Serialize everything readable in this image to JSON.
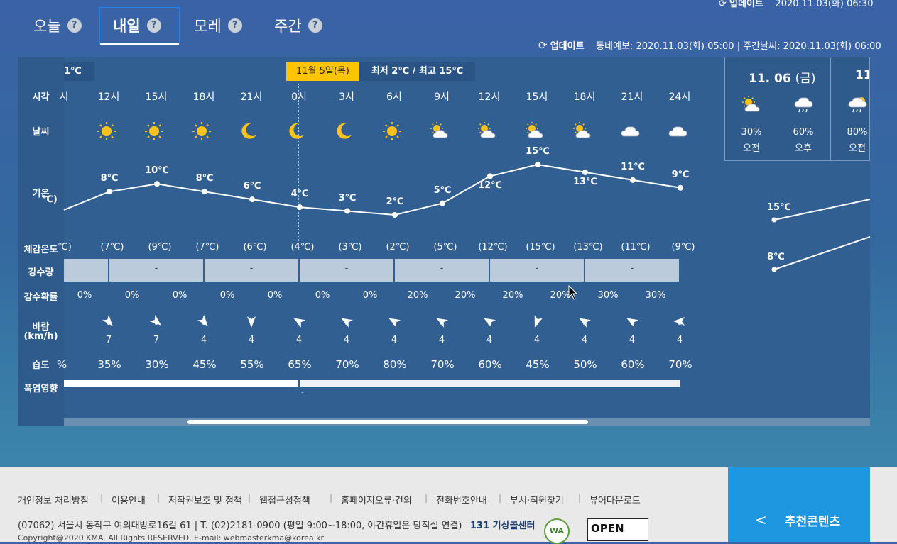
{
  "tabs": [
    {
      "label": "오늘"
    },
    {
      "label": "내일"
    },
    {
      "label": "모레"
    },
    {
      "label": "주간"
    }
  ],
  "help_glyph": "?",
  "update": {
    "label": "업데이트",
    "info": "동네예보: 2020.11.03(화) 05:00 | 주간날씨: 2020.11.03(화) 06:00",
    "top_info": "2020.11.03(화) 06:30"
  },
  "row_labels": {
    "time": "시각",
    "weather": "날씨",
    "temp": "기온",
    "feel": "체감온도",
    "precip": "강수량",
    "prob": "강수확률",
    "wind": "바람",
    "wind_unit": "(km/h)",
    "humidity": "습도",
    "heat": "폭염영향"
  },
  "day": {
    "badge": "11월 5일(목)",
    "minmax": "최저 2℃ / 최고 15℃",
    "prev_temp": "1℃"
  },
  "hours": [
    "시",
    "12시",
    "15시",
    "18시",
    "21시",
    "0시",
    "3시",
    "6시",
    "9시",
    "12시",
    "15시",
    "18시",
    "21시",
    "24시"
  ],
  "weather_icons": [
    "sun-icon",
    "sun-icon",
    "sun-icon",
    "moon-icon",
    "moon-icon",
    "moon-icon",
    "sun-icon",
    "sun-cloud-icon",
    "sun-cloud-icon",
    "sun-cloud-icon",
    "sun-cloud-icon",
    "cloud-icon",
    "cloud-icon"
  ],
  "temps": [
    "8℃",
    "10℃",
    "8℃",
    "6℃",
    "4℃",
    "3℃",
    "2℃",
    "5℃",
    "12℃",
    "15℃",
    "13℃",
    "11℃",
    "9℃"
  ],
  "temp_values": [
    8,
    10,
    8,
    6,
    4,
    3,
    2,
    5,
    12,
    15,
    13,
    11,
    9
  ],
  "feels": [
    "℃)",
    "(7℃)",
    "(9℃)",
    "(7℃)",
    "(6℃)",
    "(4℃)",
    "(3℃)",
    "(2℃)",
    "(5℃)",
    "(12℃)",
    "(15℃)",
    "(13℃)",
    "(11℃)",
    "(9℃)"
  ],
  "precip": [
    "-",
    "-",
    "-",
    "-",
    "-",
    "-"
  ],
  "prob": [
    "0%",
    "0%",
    "0%",
    "0%",
    "0%",
    "0%",
    "0%",
    "20%",
    "20%",
    "20%",
    "20%",
    "30%",
    "30%"
  ],
  "wind_speeds": [
    "",
    "7",
    "7",
    "4",
    "4",
    "4",
    "4",
    "4",
    "4",
    "4",
    "4",
    "4",
    "4",
    "4"
  ],
  "humidity": [
    "%",
    "35%",
    "30%",
    "45%",
    "55%",
    "65%",
    "70%",
    "80%",
    "70%",
    "60%",
    "45%",
    "50%",
    "60%",
    "70%"
  ],
  "heat_dash": "-",
  "outlook": {
    "date": "11. 06",
    "dow": "(금)",
    "next_date": "11",
    "items": [
      {
        "icon": "sun-cloud-icon",
        "prob": "30%",
        "period": "오전"
      },
      {
        "icon": "rain-cloud-icon",
        "prob": "60%",
        "period": "오후"
      },
      {
        "icon": "sun-rain-icon",
        "prob": "80%",
        "period": "오전"
      }
    ],
    "high": "15℃",
    "low": "8℃"
  },
  "footer": {
    "links": [
      "개인정보 처리방침",
      "이용안내",
      "저작권보호 및 정책",
      "웹접근성정책",
      "홈페이지오류·건의",
      "전화번호안내",
      "부서·직원찾기",
      "뷰어다운로드"
    ],
    "address": "(07062) 서울시 동작구 여의대방로16길 61 | T. (02)2181-0900 (평일 9:00~18:00, 야간휴일은 당직실 연결)",
    "copyright": "Copyright@2020 KMA. All Rights RESERVED. E-mail: webmasterkma@korea.kr",
    "logo1": "131 기상콜센터",
    "logo2": "WA",
    "logo3": "OPEN",
    "reco_label": "추천콘텐츠"
  }
}
